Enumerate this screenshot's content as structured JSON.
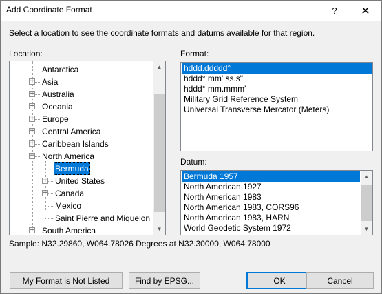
{
  "window": {
    "title": "Add Coordinate Format",
    "help_label": "?",
    "close_label": "✕"
  },
  "instructions": "Select a location to see the coordinate formats and datums available for that region.",
  "location": {
    "label": "Location:",
    "items": [
      {
        "label": "Antarctica",
        "expandable": false,
        "selected": false
      },
      {
        "label": "Asia",
        "expandable": true,
        "selected": false
      },
      {
        "label": "Australia",
        "expandable": true,
        "selected": false
      },
      {
        "label": "Oceania",
        "expandable": true,
        "selected": false
      },
      {
        "label": "Europe",
        "expandable": true,
        "selected": false
      },
      {
        "label": "Central America",
        "expandable": true,
        "selected": false
      },
      {
        "label": "Caribbean Islands",
        "expandable": true,
        "selected": false
      },
      {
        "label": "North America",
        "expandable": true,
        "expanded": true,
        "selected": false
      },
      {
        "label": "Bermuda",
        "expandable": false,
        "selected": true
      },
      {
        "label": "United States",
        "expandable": true,
        "selected": false
      },
      {
        "label": "Canada",
        "expandable": true,
        "selected": false
      },
      {
        "label": "Mexico",
        "expandable": false,
        "selected": false
      },
      {
        "label": "Saint Pierre and Miquelon",
        "expandable": false,
        "selected": false
      },
      {
        "label": "South America",
        "expandable": true,
        "selected": false
      }
    ]
  },
  "format": {
    "label": "Format:",
    "items": [
      {
        "label": "hddd.ddddd°",
        "selected": true
      },
      {
        "label": "hddd° mm' ss.s\"",
        "selected": false
      },
      {
        "label": "hddd° mm.mmm'",
        "selected": false
      },
      {
        "label": "Military Grid Reference System",
        "selected": false
      },
      {
        "label": "Universal Transverse Mercator (Meters)",
        "selected": false
      }
    ]
  },
  "datum": {
    "label": "Datum:",
    "items": [
      {
        "label": "Bermuda 1957",
        "selected": true
      },
      {
        "label": "North American 1927",
        "selected": false
      },
      {
        "label": "North American 1983",
        "selected": false
      },
      {
        "label": "North American 1983, CORS96",
        "selected": false
      },
      {
        "label": "North American 1983, HARN",
        "selected": false
      },
      {
        "label": "World Geodetic System 1972",
        "selected": false
      }
    ]
  },
  "sample": "Sample: N32.29860, W064.78026 Degrees at N32.30000, W064.78000",
  "buttons": {
    "not_listed": "My Format is Not Listed",
    "find_epsg": "Find by EPSG...",
    "ok": "OK",
    "cancel": "Cancel"
  },
  "colors": {
    "selection": "#0078d7",
    "default_button_border": "#0078d7"
  }
}
